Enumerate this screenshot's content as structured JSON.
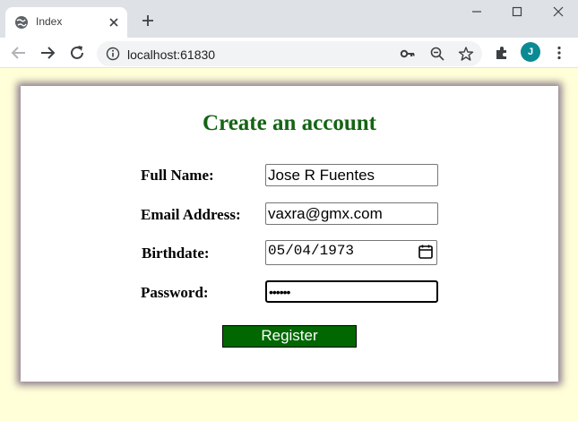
{
  "browser": {
    "tab_title": "Index",
    "url": "localhost:61830",
    "profile_initial": "J",
    "profile_color": "#0b8a94"
  },
  "icons": [
    "globe-icon",
    "close-icon",
    "plus-icon",
    "minimize-icon",
    "maximize-icon",
    "close-window-icon",
    "back-icon",
    "forward-icon",
    "reload-icon",
    "info-icon",
    "key-icon",
    "zoom-out-icon",
    "star-icon",
    "extensions-icon",
    "kebab-menu-icon",
    "calendar-icon"
  ],
  "form": {
    "title": "Create an account",
    "title_color": "#146414",
    "full_name_label": "Full Name:",
    "full_name_value": "Jose R Fuentes",
    "email_label": "Email Address:",
    "email_value": "vaxra@gmx.com",
    "birthdate_label": "Birthdate:",
    "birthdate_value": "05/04/1973",
    "password_label": "Password:",
    "password_value": "••••••",
    "submit_label": "Register",
    "submit_color": "#016701"
  },
  "colors": {
    "page_background": "#ffffd8",
    "card_shadow": "#8f7f8f"
  }
}
